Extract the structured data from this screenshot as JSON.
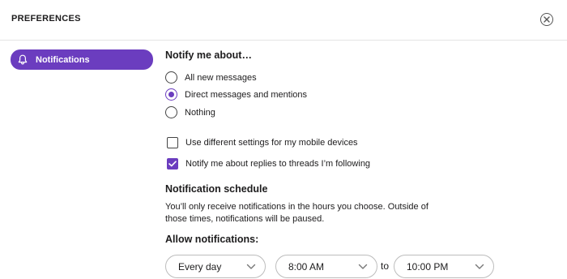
{
  "header": {
    "title": "PREFERENCES",
    "close_icon": "close-circle-icon"
  },
  "sidebar": {
    "items": [
      {
        "label": "Notifications",
        "icon": "bell-icon",
        "selected": true
      }
    ]
  },
  "colors": {
    "accent": "#6b3dbf",
    "border": "#bdbdbd",
    "text": "#1d1c1d"
  },
  "notify": {
    "heading": "Notify me about…",
    "options": [
      {
        "label": "All new messages",
        "checked": false
      },
      {
        "label": "Direct messages and mentions",
        "checked": true
      },
      {
        "label": "Nothing",
        "checked": false
      }
    ]
  },
  "checkboxes": [
    {
      "label": "Use different settings for my mobile devices",
      "checked": false
    },
    {
      "label": "Notify me about replies to threads I’m following",
      "checked": true
    }
  ],
  "schedule": {
    "heading": "Notification schedule",
    "description": "You’ll only receive notifications in the hours you choose. Outside of those times, notifications will be paused.",
    "allow_label": "Allow notifications:",
    "days_value": "Every day",
    "start_value": "8:00 AM",
    "to_label": "to",
    "end_value": "10:00 PM"
  }
}
